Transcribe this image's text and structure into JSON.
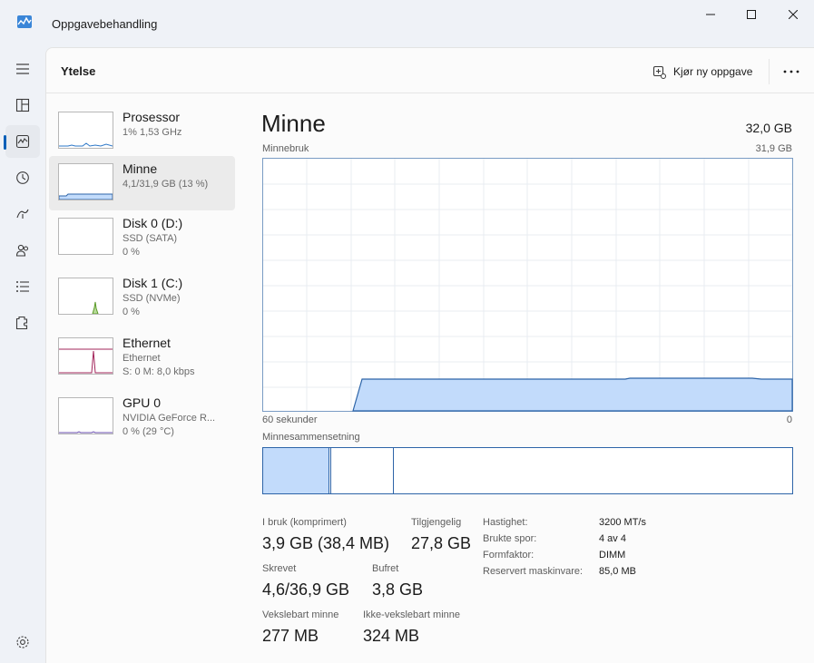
{
  "window": {
    "title": "Oppgavebehandling",
    "app_icon": "task-manager-icon"
  },
  "nav": {
    "items": [
      {
        "name": "menu",
        "icon": "hamburger-icon"
      },
      {
        "name": "processes",
        "icon": "processes-icon"
      },
      {
        "name": "performance",
        "icon": "performance-icon",
        "active": true
      },
      {
        "name": "app-history",
        "icon": "history-icon"
      },
      {
        "name": "startup",
        "icon": "startup-icon"
      },
      {
        "name": "users",
        "icon": "users-icon"
      },
      {
        "name": "details",
        "icon": "details-icon"
      },
      {
        "name": "services",
        "icon": "services-icon"
      },
      {
        "name": "settings",
        "icon": "settings-icon"
      }
    ]
  },
  "header": {
    "title": "Ytelse",
    "run_task_label": "Kjør ny oppgave"
  },
  "devices": [
    {
      "name": "Prosessor",
      "line1": "1% 1,53 GHz",
      "line2": ""
    },
    {
      "name": "Minne",
      "line1": "4,1/31,9 GB (13 %)",
      "line2": "",
      "selected": true
    },
    {
      "name": "Disk 0 (D:)",
      "line1": "SSD (SATA)",
      "line2": "0 %"
    },
    {
      "name": "Disk 1 (C:)",
      "line1": "SSD (NVMe)",
      "line2": "0 %"
    },
    {
      "name": "Ethernet",
      "line1": "Ethernet",
      "line2": "S: 0 M: 8,0 kbps"
    },
    {
      "name": "GPU 0",
      "line1": "NVIDIA GeForce R...",
      "line2": "0 % (29 °C)"
    }
  ],
  "main": {
    "title": "Minne",
    "total": "32,0 GB",
    "usage_label": "Minnebruk",
    "usage_max": "31,9 GB",
    "axis_left": "60 sekunder",
    "axis_right": "0",
    "composition_label": "Minnesammensetning",
    "stats": {
      "in_use_label": "I bruk (komprimert)",
      "in_use_value": "3,9 GB (38,4 MB)",
      "available_label": "Tilgjengelig",
      "available_value": "27,8 GB",
      "committed_label": "Skrevet",
      "committed_value": "4,6/36,9 GB",
      "cached_label": "Bufret",
      "cached_value": "3,8 GB",
      "paged_label": "Vekslebart minne",
      "paged_value": "277 MB",
      "nonpaged_label": "Ikke-vekslebart minne",
      "nonpaged_value": "324 MB"
    },
    "details": [
      {
        "label": "Hastighet:",
        "value": "3200 MT/s"
      },
      {
        "label": "Brukte spor:",
        "value": "4 av 4"
      },
      {
        "label": "Formfaktor:",
        "value": "DIMM"
      },
      {
        "label": "Reservert maskinvare:",
        "value": "85,0 MB"
      }
    ]
  },
  "colors": {
    "memory_fill": "#c2dbfb",
    "memory_line": "#2d64a8",
    "cpu_line": "#2d78c8",
    "disk1_line": "#5c9a2a",
    "ethernet_line": "#a2245a",
    "accent": "#005fb8"
  }
}
